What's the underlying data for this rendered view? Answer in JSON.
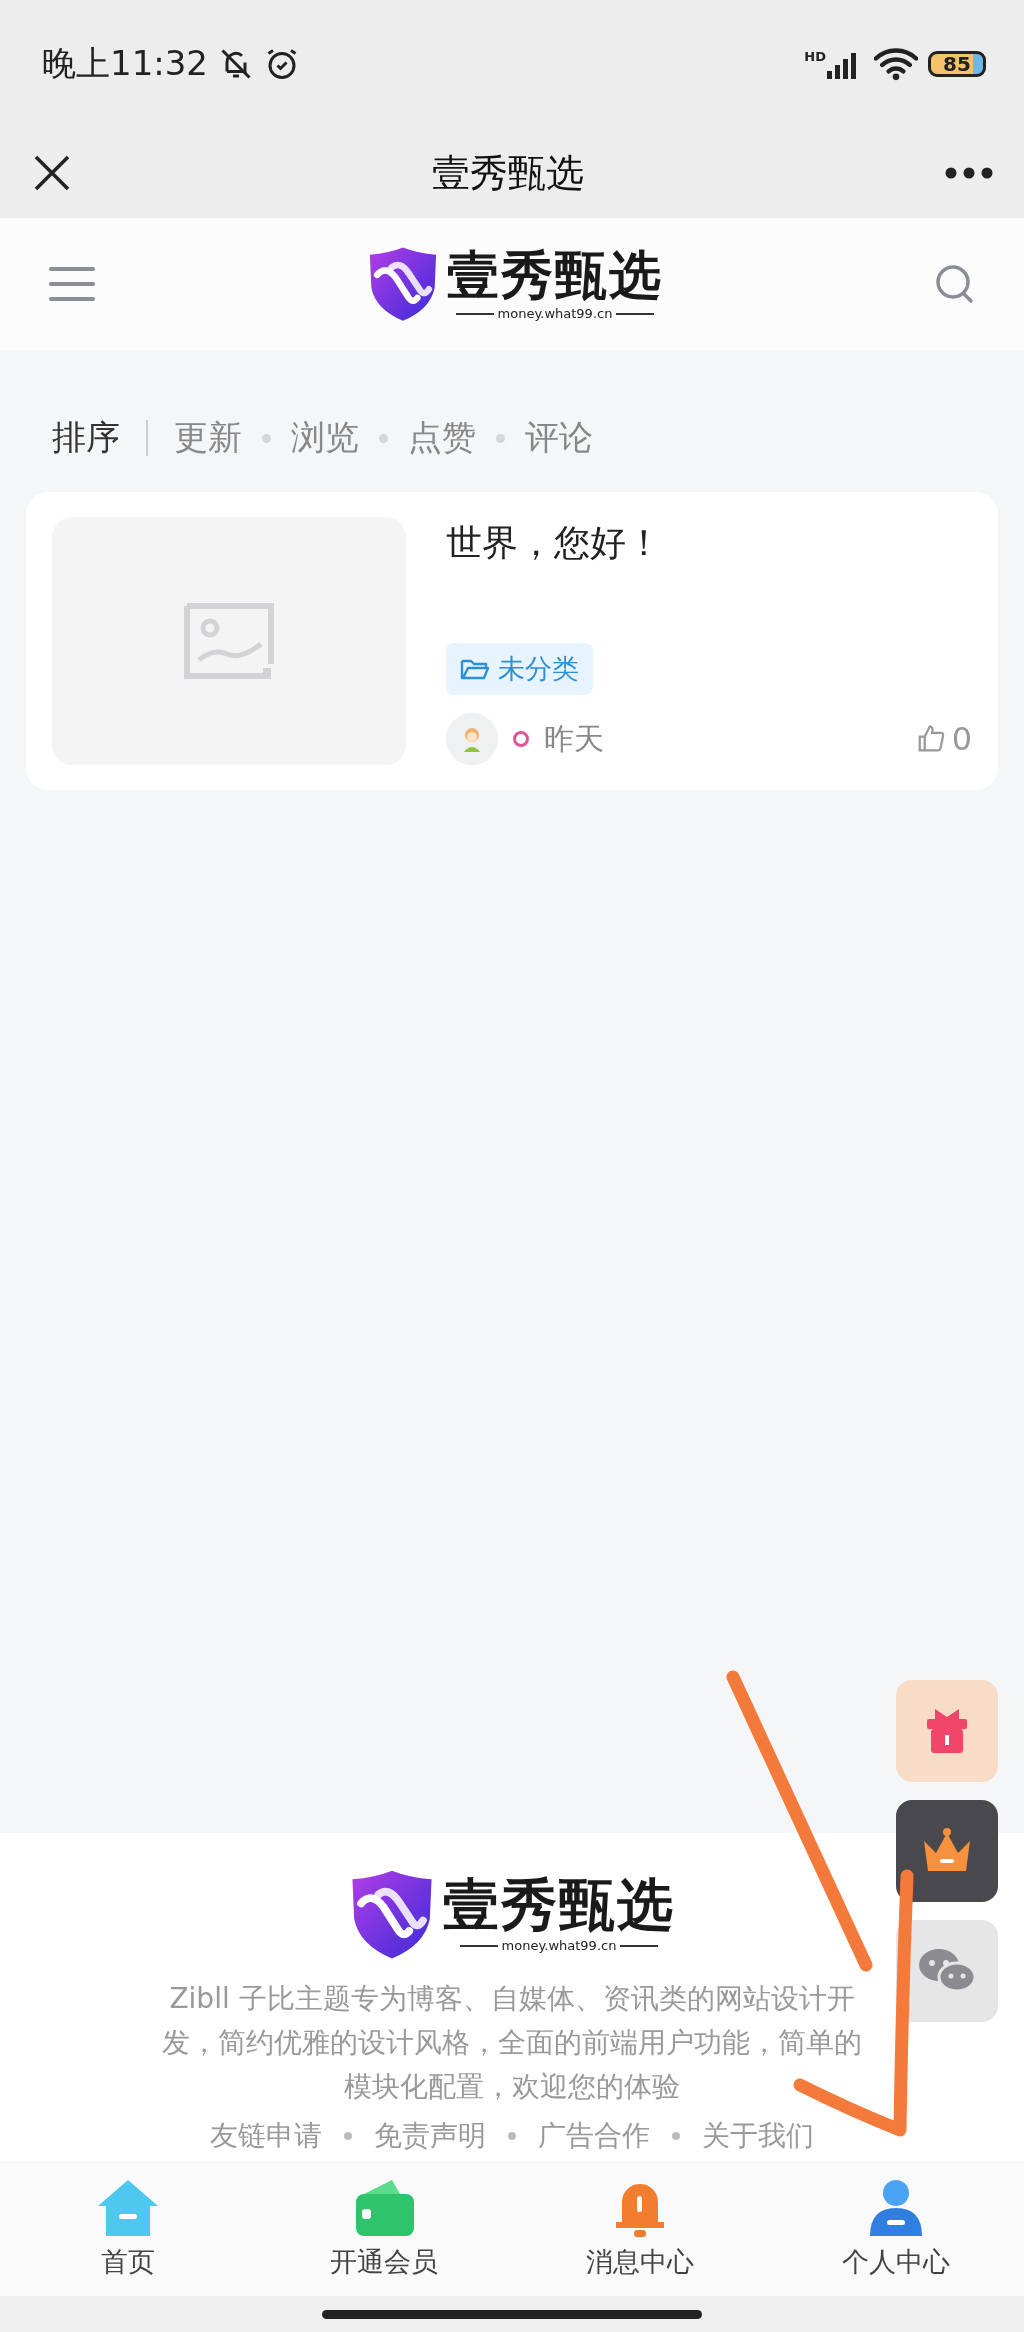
{
  "status_bar": {
    "time": "晚上11:32",
    "network": "HD",
    "battery": "85"
  },
  "title_bar": {
    "title": "壹秀甄选"
  },
  "site_header": {
    "logo_text": "壹秀甄选",
    "logo_url": "money.what99.cn"
  },
  "sort_bar": {
    "label": "排序",
    "options": [
      "更新",
      "浏览",
      "点赞",
      "评论"
    ]
  },
  "posts": [
    {
      "title": "世界，您好！",
      "category": "未分类",
      "time": "昨天",
      "likes": "0"
    }
  ],
  "footer": {
    "logo_text": "壹秀甄选",
    "logo_url": "money.what99.cn",
    "description": "Zibll 子比主题专为博客、自媒体、资讯类的网站设计开发，简约优雅的设计风格，全面的前端用户功能，简单的模块化配置，欢迎您的体验",
    "links": [
      "友链申请",
      "免责声明",
      "广告合作",
      "关于我们"
    ]
  },
  "float_buttons": [
    {
      "kind": "gift"
    },
    {
      "kind": "crown"
    },
    {
      "kind": "wechat"
    }
  ],
  "tab_bar": [
    {
      "kind": "home",
      "label": "首页"
    },
    {
      "kind": "wallet",
      "label": "开通会员"
    },
    {
      "kind": "bell",
      "label": "消息中心"
    },
    {
      "kind": "user",
      "label": "个人中心"
    }
  ],
  "annotation": {
    "kind": "arrow"
  }
}
